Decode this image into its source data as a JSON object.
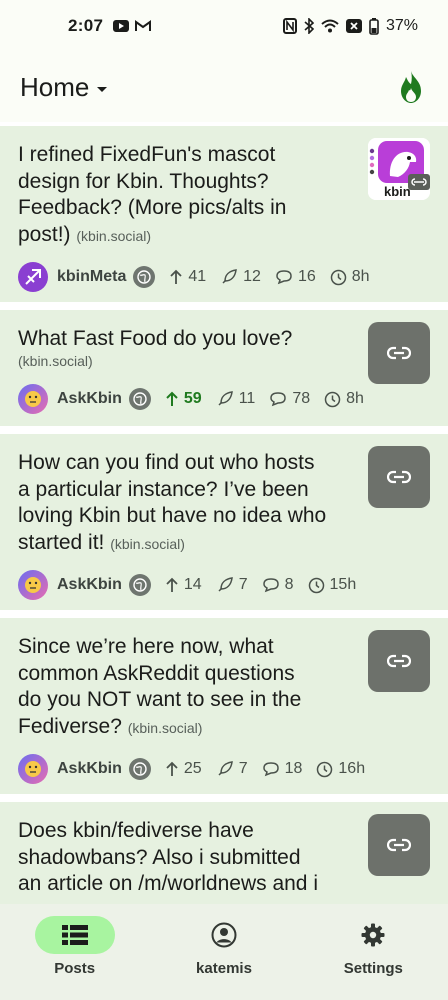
{
  "status": {
    "time": "2:07",
    "battery": "37%"
  },
  "header": {
    "title": "Home"
  },
  "posts": [
    {
      "title_lines": [
        "I refined FixedFun's mascot",
        "design for Kbin. Thoughts?",
        "Feedback? (More pics/alts in",
        "post!)"
      ],
      "domain": "(kbin.social)",
      "magazine": "kbinMeta",
      "upvotes": "41",
      "boosts": "12",
      "comments": "16",
      "age": "8h",
      "upvoted": false,
      "thumb_label": "kbin"
    },
    {
      "title_lines": [
        "What Fast Food do you love?"
      ],
      "domain": "(kbin.social)",
      "magazine": "AskKbin",
      "upvotes": "59",
      "boosts": "11",
      "comments": "78",
      "age": "8h",
      "upvoted": true
    },
    {
      "title_lines": [
        "How can you find out who hosts",
        "a particular instance? I’ve been",
        "loving Kbin but have no idea who",
        "started it!"
      ],
      "domain": "(kbin.social)",
      "magazine": "AskKbin",
      "upvotes": "14",
      "boosts": "7",
      "comments": "8",
      "age": "15h",
      "upvoted": false
    },
    {
      "title_lines": [
        "Since we’re here now, what",
        "common AskReddit questions",
        "do you NOT want to see in the",
        "Fediverse?"
      ],
      "domain": "(kbin.social)",
      "magazine": "AskKbin",
      "upvotes": "25",
      "boosts": "7",
      "comments": "18",
      "age": "16h",
      "upvoted": false
    },
    {
      "title_lines": [
        "Does kbin/fediverse have",
        "shadowbans? Also i submitted",
        "an article on /m/worldnews and i"
      ]
    }
  ],
  "nav": {
    "posts": "Posts",
    "user": "katemis",
    "settings": "Settings"
  },
  "colors": {
    "accent": "#1f7a1f",
    "card_bg": "#e6f1e0",
    "active_pill": "#a8f4a0",
    "link_thumb": "#6d716b"
  }
}
